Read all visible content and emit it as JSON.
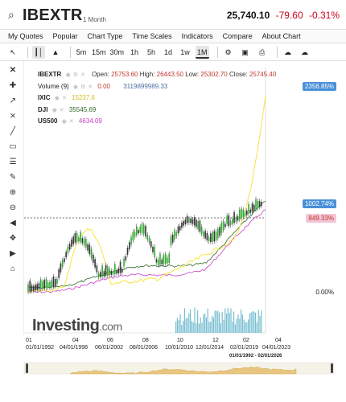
{
  "header": {
    "symbol": "IBEXTR",
    "period": "1 Month",
    "last": "25,740.10",
    "change": "-79.60",
    "change_pct": "-0.31%"
  },
  "menu": [
    "My Quotes",
    "Popular",
    "Chart Type",
    "Time Scales",
    "Indicators",
    "Compare",
    "About Chart"
  ],
  "toolbar": {
    "timeframes": [
      "5m",
      "15m",
      "30m",
      "1h",
      "5h",
      "1d",
      "1w",
      "1M"
    ],
    "selected_timeframe": "1M"
  },
  "legend": {
    "main": {
      "name": "IBEXTR",
      "open_label": "Open:",
      "open": "25753.60",
      "high_label": "High:",
      "high": "26443.50",
      "low_label": "Low:",
      "low": "25302.70",
      "close_label": "Close:",
      "close": "25745.40"
    },
    "volume": {
      "name": "Volume (9)",
      "value": "0.00",
      "extra": "3119899989.33"
    },
    "compare": [
      {
        "name": "IXIC",
        "value": "15237.6",
        "color": "#f5e642"
      },
      {
        "name": "DJI",
        "value": "35545.69",
        "color": "#2e6b2a"
      },
      {
        "name": "US500",
        "value": "4634.09",
        "color": "#c840c8"
      }
    ]
  },
  "y_labels": {
    "top": "2356.85%",
    "mid": "1002.74%",
    "cur": "849.33%",
    "zero": "0.00%"
  },
  "x_labels": [
    {
      "top": "01",
      "bottom": "01/01/1992"
    },
    {
      "top": "04",
      "bottom": "04/01/1998"
    },
    {
      "top": "06",
      "bottom": "06/01/2002"
    },
    {
      "top": "08",
      "bottom": "08/01/2006"
    },
    {
      "top": "10",
      "bottom": "10/01/2010"
    },
    {
      "top": "12",
      "bottom": "12/01/2014"
    },
    {
      "top": "02",
      "bottom": "02/01/2019"
    },
    {
      "top": "04",
      "bottom": "04/01/2023"
    }
  ],
  "navigator": {
    "range": "01/01/1992 - 02/01/2026"
  },
  "watermark": {
    "brand": "Investing",
    "suffix": ".com"
  },
  "colors": {
    "ibex": "#222222",
    "ixic": "#f5e642",
    "dji": "#2e6b2a",
    "us500": "#c840c8",
    "volume": "#5fb3c9",
    "accent": "#4a90d9"
  }
}
